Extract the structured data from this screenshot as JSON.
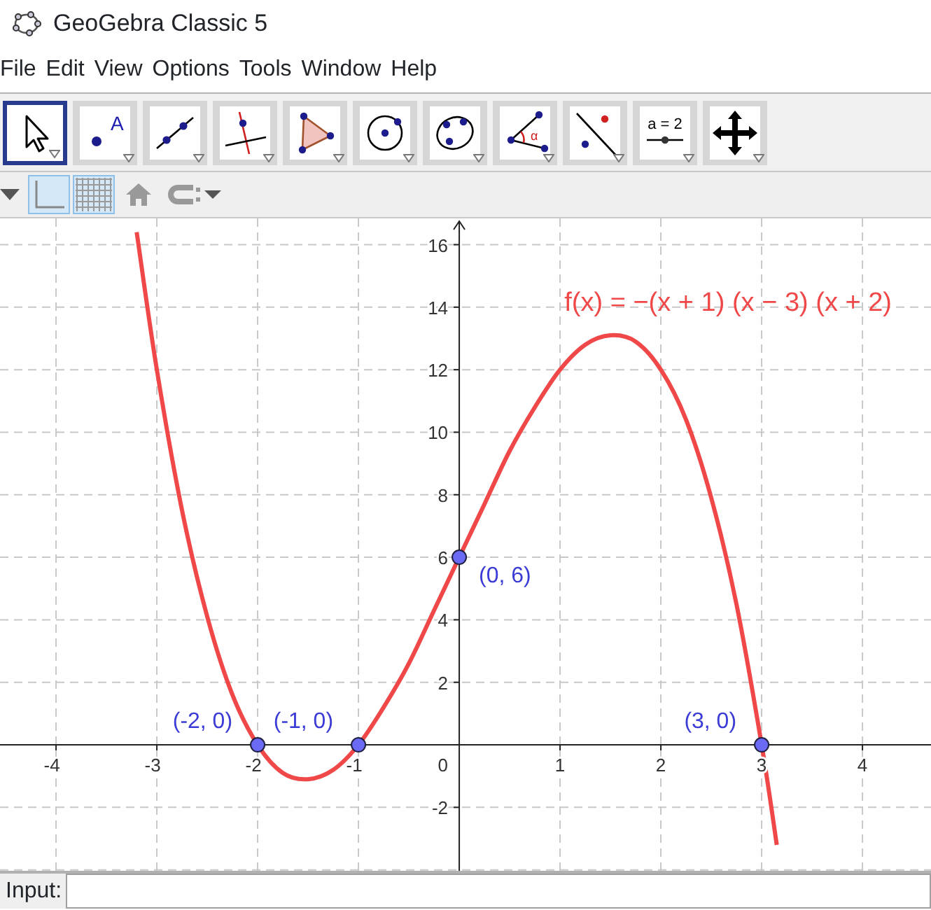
{
  "window": {
    "title": "GeoGebra Classic 5"
  },
  "menu": [
    "File",
    "Edit",
    "View",
    "Options",
    "Tools",
    "Window",
    "Help"
  ],
  "toolbar": [
    {
      "kind": "move",
      "selected": true
    },
    {
      "kind": "point",
      "selected": false,
      "label": "A"
    },
    {
      "kind": "line",
      "selected": false
    },
    {
      "kind": "perpendicular",
      "selected": false
    },
    {
      "kind": "polygon",
      "selected": false
    },
    {
      "kind": "circle",
      "selected": false
    },
    {
      "kind": "conic",
      "selected": false
    },
    {
      "kind": "angle",
      "selected": false,
      "label": "α"
    },
    {
      "kind": "reflect",
      "selected": false
    },
    {
      "kind": "slider",
      "selected": false,
      "label": "a = 2"
    },
    {
      "kind": "move-view",
      "selected": false
    }
  ],
  "style_bar": {
    "axes_on": true,
    "grid_on": true
  },
  "graphics": {
    "chart_data": {
      "type": "line",
      "grid": true,
      "xlim": [
        -4.556,
        4.68
      ],
      "ylim": [
        -4.03,
        16.84
      ],
      "xticks": [
        -4,
        -3,
        -2,
        -1,
        1,
        2,
        3,
        4
      ],
      "yticks": [
        -2,
        2,
        4,
        6,
        8,
        10,
        12,
        14,
        16
      ],
      "x": [
        -3.2,
        -3,
        -2.75,
        -2.5,
        -2.25,
        -2,
        -1.75,
        -1.5,
        -1.25,
        -1,
        -0.75,
        -0.5,
        -0.25,
        0,
        0.25,
        0.5,
        0.75,
        1,
        1.25,
        1.5,
        1.75,
        2,
        2.25,
        2.5,
        2.75,
        3,
        3.15
      ],
      "series": [
        {
          "name": "f(x) = −(x + 1) (x − 3) (x + 2)",
          "color": "#f04848",
          "values": [
            16.4,
            12,
            7.5,
            4.1,
            1.6,
            0,
            -0.9,
            -1.1,
            -0.8,
            0,
            1.2,
            2.6,
            4.3,
            6,
            7.7,
            9.4,
            10.8,
            12,
            12.8,
            13.1,
            12.9,
            12,
            10.4,
            7.9,
            4.5,
            0,
            -3.2
          ]
        }
      ],
      "annotations": [
        {
          "x": -2,
          "y": 0,
          "text": "(-2, 0)"
        },
        {
          "x": -1,
          "y": 0,
          "text": "(-1, 0)"
        },
        {
          "x": 0,
          "y": 6,
          "text": "(0, 6)"
        },
        {
          "x": 3,
          "y": 0,
          "text": "(3, 0)"
        }
      ]
    },
    "origin_label": "0"
  },
  "input_bar": {
    "label": "Input:"
  }
}
